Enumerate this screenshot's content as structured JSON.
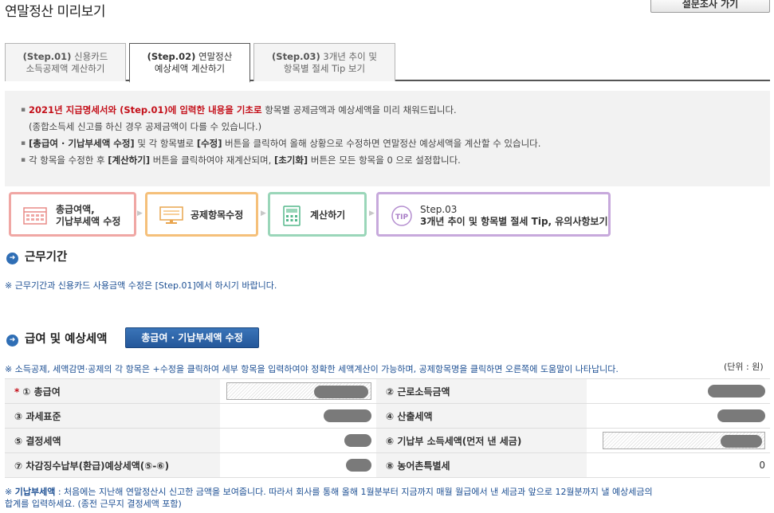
{
  "header": {
    "title": "연말정산 미리보기",
    "survey_button": "설문조사 가기"
  },
  "tabs": [
    {
      "step": "(Step.01)",
      "line1_rest": " 신용카드",
      "line2": "소득공제액 계산하기"
    },
    {
      "step": "(Step.02)",
      "line1_rest": " 연말정산",
      "line2": "예상세액 계산하기"
    },
    {
      "step": "(Step.03)",
      "line1_rest": " 3개년 추이 및",
      "line2": "항목별 절세 Tip 보기"
    }
  ],
  "notice": {
    "l1_red": "2021년 지급명세서와 (Step.01)에 입력한 내용을 기초로",
    "l1_rest": " 항목별 공제금액과 예상세액을 미리 채워드립니다.",
    "l1_sub": "(종합소득세 신고를 하신 경우 공제금액이 다를 수 있습니다.)",
    "l2_bold1": "[총급여 · 기납부세액 수정]",
    "l2_mid": " 및 각 항목별로 ",
    "l2_bold2": "[수정]",
    "l2_rest": " 버튼을 클릭하여 올해 상황으로 수정하면 연말정산 예상세액을 계산할 수 있습니다.",
    "l3_a": "각 항목을 수정한 후 ",
    "l3_bold1": "[계산하기]",
    "l3_b": " 버튼을 클릭하여야 재계산되며, ",
    "l3_bold2": "[초기화]",
    "l3_c": " 버튼은 모든 항목을 0 으로 설정합니다."
  },
  "process_steps": [
    {
      "line1": "총급여액,",
      "line2": "기납부세액 수정",
      "color": "#f0a7a4"
    },
    {
      "line1": "공제항목수정",
      "color": "#f5c07a"
    },
    {
      "line1": "계산하기",
      "color": "#9ad6b9"
    },
    {
      "line1": "Step.03",
      "line2": "3개년 추이 및 항목별 절세 Tip, 유의사항보기",
      "badge": "TIP",
      "color": "#c7a9dc"
    }
  ],
  "work_period": {
    "title": "근무기간",
    "note": "※ 근무기간과 신용카드 사용금액 수정은 [Step.01]에서 하시기 바랍니다."
  },
  "salary": {
    "title": "급여 및 예상세액",
    "edit_button": "총급여 · 기납부세액 수정",
    "note": "※ 소득공제, 세액감면·공제의 각 항목은 +수정을 클릭하여 세부 항목을 입력하여야 정확한 세액계산이 가능하며, 공제항목명을 클릭하면 오른쪽에 도움말이 나타납니다.",
    "unit": "(단위 : 원)",
    "rows": [
      {
        "left_label": "① 총급여",
        "left_required": "*",
        "right_label": "② 근로소득금액",
        "right_value": ""
      },
      {
        "left_label": "③ 과세표준",
        "right_label": "④ 산출세액"
      },
      {
        "left_label": "⑤ 결정세액",
        "right_label": "⑥ 기납부 소득세액(먼저 낸 세금)"
      },
      {
        "left_label": "⑦ 차감징수납부(환급)예상세액(⑤-⑥)",
        "right_label": "⑧ 농어촌특별세",
        "right_value": "0"
      }
    ],
    "footnote_bold": "기납부세액",
    "footnote_rest": " : 처음에는 지난해 연말정산시 신고한 금액을 보여줍니다. 따라서 회사를 통해 올해 1월분부터 지금까지 매월 월급에서 낸 세금과 앞으로 12월분까지 낼 예상세금의",
    "footnote_line2": "합계를 입력하세요. (종전 근무지 결정세액 포함)"
  },
  "colors": {
    "accent_blue": "#2f6eb5",
    "note_blue": "#1c4f93",
    "required_red": "#c4111b"
  }
}
